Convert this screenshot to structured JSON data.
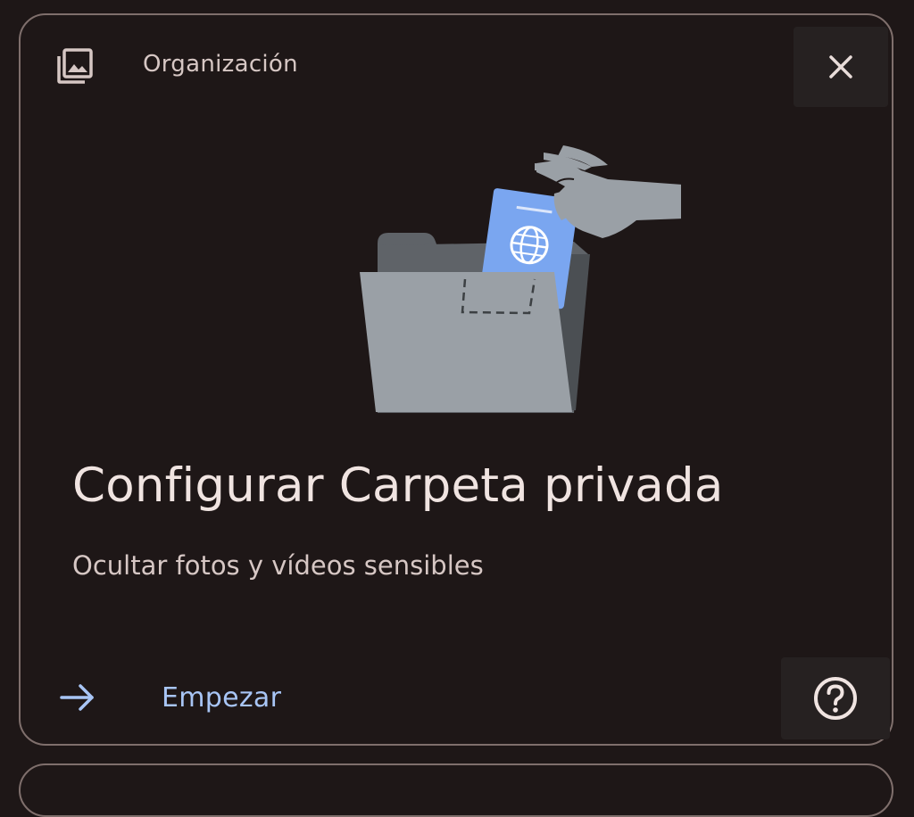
{
  "card": {
    "header": {
      "label": "Organización",
      "icon": "photo-library-icon",
      "close_icon": "close-icon"
    },
    "illustration": "private-folder-illustration",
    "title": "Configurar Carpeta privada",
    "subtitle": "Ocultar fotos y vídeos sensibles",
    "action": {
      "label": "Empezar",
      "icon": "arrow-right-icon"
    },
    "help_icon": "help-icon"
  },
  "colors": {
    "background": "#1e1717",
    "card_border": "#7f6f6c",
    "title_text": "#f0e4e1",
    "secondary_text": "#d6c7c4",
    "accent_blue": "#a8c5f5",
    "button_bg": "#262121",
    "folder_gray": "#9aa0a6",
    "passport_blue": "#7aa6f0"
  }
}
